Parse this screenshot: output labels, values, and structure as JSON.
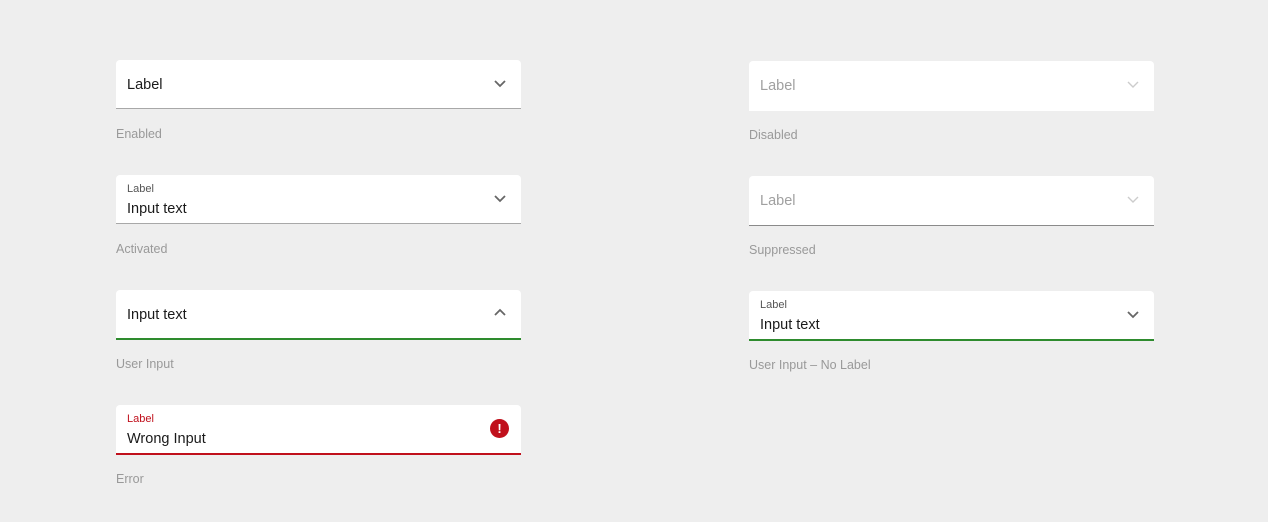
{
  "left": [
    {
      "label": "Label",
      "value": "",
      "caption": "Enabled",
      "state": "enabled",
      "icon": "chevron-down-icon"
    },
    {
      "label": "Label",
      "value": "Input text",
      "caption": "Activated",
      "state": "activated",
      "icon": "chevron-down-icon"
    },
    {
      "label": "",
      "value": "Input text",
      "caption": "User Input",
      "state": "user-input",
      "icon": "chevron-up-icon"
    },
    {
      "label": "Label",
      "value": "Wrong Input",
      "caption": "Error",
      "state": "error",
      "icon": "error-icon",
      "icon_glyph": "!"
    }
  ],
  "right": [
    {
      "label": "Label",
      "value": "",
      "caption": "Disabled",
      "state": "disabled",
      "icon": "chevron-down-icon"
    },
    {
      "label": "Label",
      "value": "",
      "caption": "Suppressed",
      "state": "suppressed",
      "icon": "chevron-down-icon"
    },
    {
      "label": "Label",
      "value": "Input text",
      "caption": "User Input – No Label",
      "state": "user-input",
      "icon": "chevron-down-icon"
    }
  ],
  "colors": {
    "background": "#eeeeee",
    "active": "#2e8b2e",
    "error": "#c0101c"
  }
}
